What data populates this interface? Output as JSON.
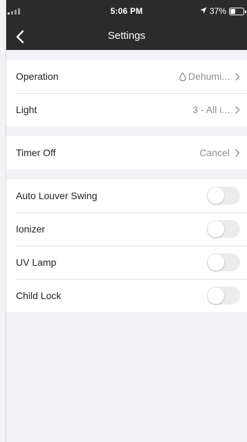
{
  "status_bar": {
    "time": "5:06 PM",
    "battery_text": "37%",
    "battery_level": 0.37,
    "location_icon": "location-arrow-icon",
    "signal_icon": "signal-bars-icon"
  },
  "nav": {
    "title": "Settings",
    "back_icon": "chevron-left-icon"
  },
  "groups": {
    "mode": [
      {
        "label": "Operation",
        "value": "Dehumi...",
        "icon": "water-drop-icon"
      },
      {
        "label": "Light",
        "value": "3 - All i..."
      }
    ],
    "timer": [
      {
        "label": "Timer Off",
        "value": "Cancel"
      }
    ],
    "toggles": [
      {
        "label": "Auto Louver Swing",
        "on": false
      },
      {
        "label": "Ionizer",
        "on": false
      },
      {
        "label": "UV Lamp",
        "on": false
      },
      {
        "label": "Child Lock",
        "on": false
      }
    ]
  },
  "colors": {
    "header_bg": "#2b2b2b",
    "page_bg": "#f2f2f7",
    "secondary_text": "#8e8e93",
    "toggle_off": "#ececec"
  }
}
